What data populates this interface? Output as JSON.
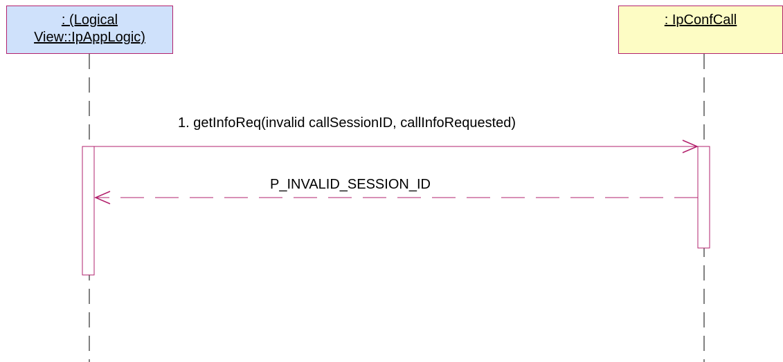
{
  "colors": {
    "line": "#b2206c",
    "app_fill": "#cfe1fb",
    "conf_fill": "#fdfcc4",
    "lifeline": "#000000"
  },
  "participants": [
    {
      "line1": ": (Logical",
      "line2": "View::IpAppLogic)"
    },
    {
      "line1": ": IpConfCall"
    }
  ],
  "messages": [
    {
      "label": "1. getInfoReq(invalid callSessionID, callInfoRequested)",
      "kind": "call"
    },
    {
      "label": "P_INVALID_SESSION_ID",
      "kind": "return"
    }
  ]
}
